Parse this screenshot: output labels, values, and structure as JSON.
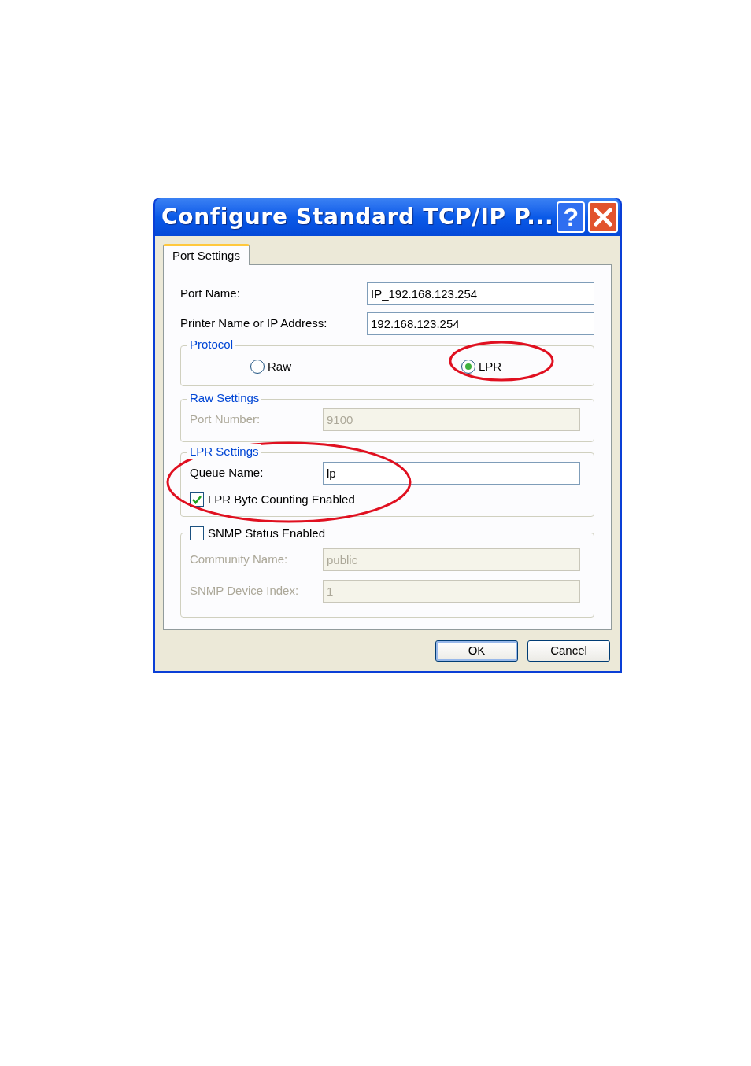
{
  "window": {
    "title": "Configure Standard TCP/IP P...",
    "help_label": "?"
  },
  "tabs": [
    {
      "label": "Port Settings",
      "selected": true
    }
  ],
  "fields": [
    {
      "label": "Port Name:",
      "value": "IP_192.168.123.254"
    },
    {
      "label": "Printer Name or IP Address:",
      "value": "192.168.123.254"
    }
  ],
  "protocol": {
    "title": "Protocol",
    "options": [
      {
        "label": "Raw",
        "selected": false
      },
      {
        "label": "LPR",
        "selected": true
      }
    ]
  },
  "raw_settings": {
    "title": "Raw Settings",
    "disabled": true,
    "fields": [
      {
        "label": "Port Number:",
        "value": "9100"
      }
    ]
  },
  "lpr_settings": {
    "title": "LPR Settings",
    "disabled": false,
    "fields": [
      {
        "label": "Queue Name:",
        "value": "lp"
      }
    ],
    "checkbox": {
      "label": "LPR Byte Counting Enabled",
      "checked": true
    }
  },
  "snmp": {
    "checkbox": {
      "label": "SNMP Status Enabled",
      "checked": false
    },
    "fields": [
      {
        "label": "Community Name:",
        "value": "public"
      },
      {
        "label": "SNMP Device Index:",
        "value": "1"
      }
    ]
  },
  "buttons": [
    {
      "label": "OK",
      "default": true
    },
    {
      "label": "Cancel",
      "default": false
    }
  ]
}
